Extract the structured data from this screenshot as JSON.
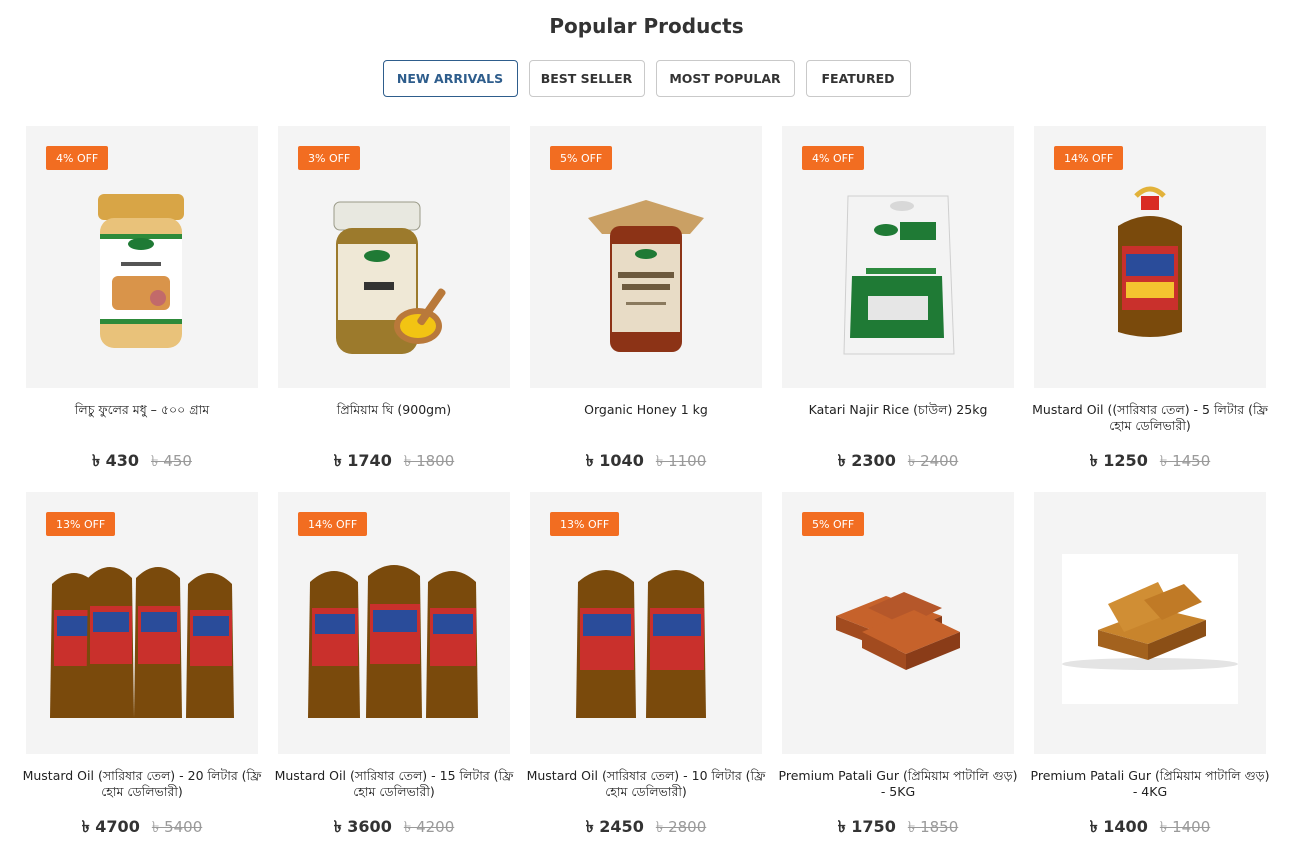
{
  "section": {
    "title": "Popular Products"
  },
  "tabs": [
    {
      "label": "NEW ARRIVALS",
      "active": true
    },
    {
      "label": "BEST SELLER",
      "active": false
    },
    {
      "label": "MOST POPULAR",
      "active": false
    },
    {
      "label": "FEATURED",
      "active": false
    }
  ],
  "currency_symbol": "৳",
  "products": [
    {
      "name": "লিচু ফুলের মধু – ৫০০ গ্রাম",
      "discount": "4% OFF",
      "price": "৳ 430",
      "old_price": "৳ 450",
      "image_icon": "honey-jar-icon"
    },
    {
      "name": "প্রিমিয়াম ঘি (900gm)",
      "discount": "3% OFF",
      "price": "৳ 1740",
      "old_price": "৳ 1800",
      "image_icon": "ghee-jar-icon"
    },
    {
      "name": "Organic Honey 1 kg",
      "discount": "5% OFF",
      "price": "৳ 1040",
      "old_price": "৳ 1100",
      "image_icon": "organic-honey-jar-icon"
    },
    {
      "name": "Katari Najir Rice (চাউল) 25kg",
      "discount": "4% OFF",
      "price": "৳ 2300",
      "old_price": "৳ 2400",
      "image_icon": "rice-bag-icon"
    },
    {
      "name": "Mustard Oil ((সারিষার তেল) - 5 লিটার (ফ্রি হোম ডেলিভারী)",
      "discount": "14% OFF",
      "price": "৳ 1250",
      "old_price": "৳ 1450",
      "image_icon": "oil-bottle-icon"
    },
    {
      "name": "Mustard Oil (সারিষার তেল) - 20 লিটার (ফ্রি হোম ডেলিভারী)",
      "discount": "13% OFF",
      "price": "৳ 4700",
      "old_price": "৳ 5400",
      "image_icon": "oil-bottles-4-icon"
    },
    {
      "name": "Mustard Oil (সারিষার তেল) - 15 লিটার (ফ্রি হোম ডেলিভারী)",
      "discount": "14% OFF",
      "price": "৳ 3600",
      "old_price": "৳ 4200",
      "image_icon": "oil-bottles-3-icon"
    },
    {
      "name": "Mustard Oil (সারিষার তেল) - 10 লিটার (ফ্রি হোম ডেলিভারী)",
      "discount": "13% OFF",
      "price": "৳ 2450",
      "old_price": "৳ 2800",
      "image_icon": "oil-bottles-2-icon"
    },
    {
      "name": "Premium Patali Gur (প্রিমিয়াম পাটালি গুড়) - 5KG",
      "discount": "5% OFF",
      "price": "৳ 1750",
      "old_price": "৳ 1850",
      "image_icon": "patali-gur-icon"
    },
    {
      "name": "Premium Patali Gur (প্রিমিয়াম পাটালি গুড়) - 4KG",
      "discount": "",
      "price": "৳ 1400",
      "old_price": "৳ 1400",
      "image_icon": "patali-gur-icon"
    }
  ],
  "colors": {
    "badge": "#f26d21",
    "active_tab": "#2e5d8c",
    "card_bg": "#f4f4f4"
  }
}
